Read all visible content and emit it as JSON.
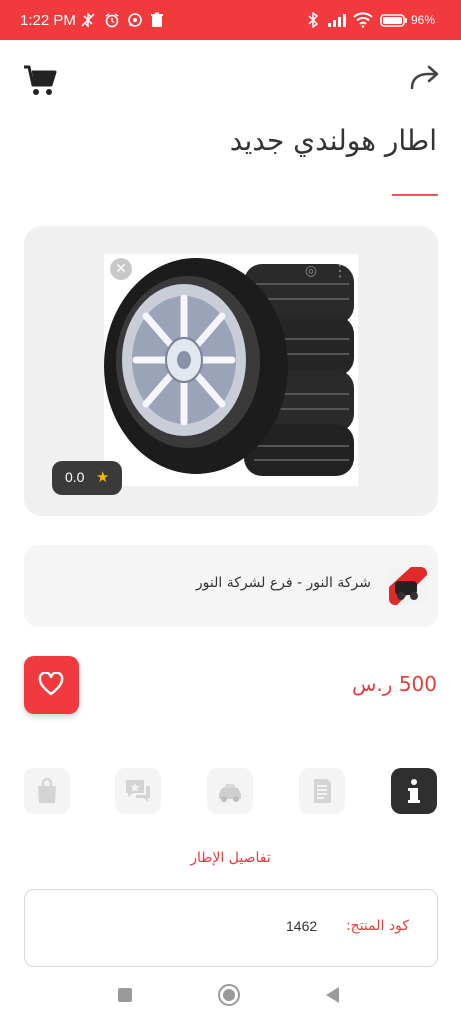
{
  "status_bar": {
    "time": "1:22 PM",
    "battery": "96%",
    "background": "#f03a3e",
    "icons": [
      "bluetooth-muted-icon",
      "alarm-icon",
      "whatsapp-icon",
      "trash-icon",
      "bluetooth-icon",
      "signal-icon",
      "wifi-icon",
      "battery-icon"
    ]
  },
  "header": {
    "cart_icon": "cart-icon",
    "share_icon": "share-icon",
    "title": "اطار هولندي جديد"
  },
  "product": {
    "rating": "0.0",
    "image": "tire-stack-image"
  },
  "store": {
    "name": "شركة النور - فرع لشركة النور"
  },
  "price": {
    "text": "500 ر.س",
    "color": "#e53c3c"
  },
  "tabs": [
    {
      "icon": "info-icon",
      "active": true
    },
    {
      "icon": "document-icon",
      "active": false
    },
    {
      "icon": "car-icon",
      "active": false
    },
    {
      "icon": "reviews-icon",
      "active": false
    },
    {
      "icon": "shopping-bag-icon",
      "active": false
    }
  ],
  "tab_section_label": "تفاصيل الإطار",
  "details": {
    "code_label": "كود المنتج:",
    "code_value": "1462"
  },
  "accent_color": "#f03a3e"
}
